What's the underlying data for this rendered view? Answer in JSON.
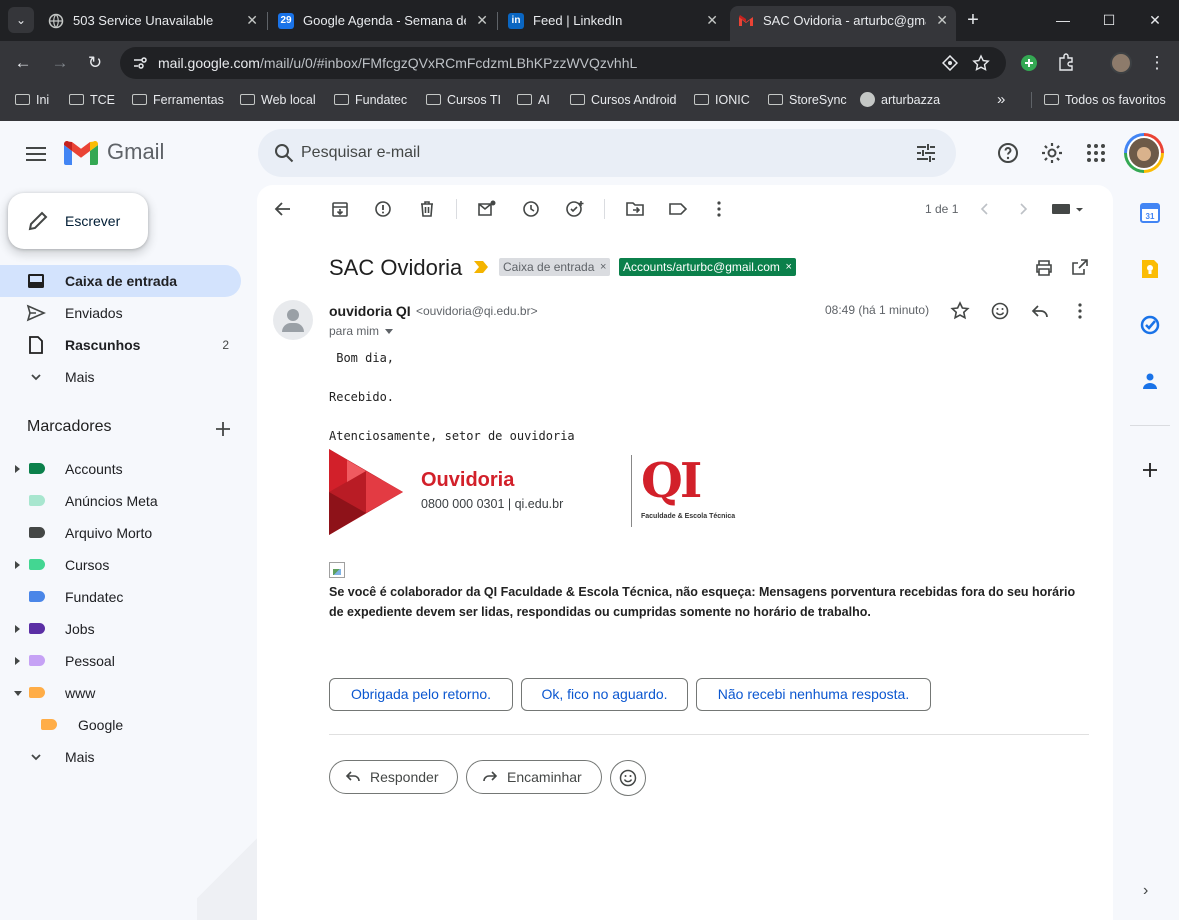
{
  "browser": {
    "tabs": [
      {
        "title": "503 Service Unavailable",
        "icon": "globe-icon"
      },
      {
        "title": "Google Agenda - Semana de",
        "icon": "calendar-icon"
      },
      {
        "title": "Feed | LinkedIn",
        "icon": "linkedin-icon"
      },
      {
        "title": "SAC Ovidoria - arturbc@gmai",
        "icon": "gmail-icon",
        "active": true
      }
    ],
    "url_host": "mail.google.com",
    "url_path": "/mail/u/0/#inbox/FMfcgzQVxRCmFcdzmLBhKPzzWVQzvhhL",
    "bookmarks": [
      "Ini",
      "TCE",
      "Ferramentas",
      "Web local",
      "Fundatec",
      "Cursos TI",
      "AI",
      "Cursos Android",
      "IONIC",
      "StoreSync",
      "arturbazza"
    ],
    "bookmarks_overflow": "»",
    "bookmarks_all": "Todos os favoritos"
  },
  "gmail": {
    "brand": "Gmail",
    "search_placeholder": "Pesquisar e-mail",
    "compose_label": "Escrever",
    "nav": [
      {
        "label": "Caixa de entrada",
        "selected": true,
        "bold": true
      },
      {
        "label": "Enviados"
      },
      {
        "label": "Rascunhos",
        "bold": true,
        "count": "2"
      },
      {
        "label": "Mais"
      }
    ],
    "labels_title": "Marcadores",
    "labels": [
      {
        "name": "Accounts",
        "color": "#0b804b",
        "expandable": true
      },
      {
        "name": "Anúncios Meta",
        "color": "#a8e6cf"
      },
      {
        "name": "Arquivo Morto",
        "color": "#444746"
      },
      {
        "name": "Cursos",
        "color": "#43d692",
        "expandable": true
      },
      {
        "name": "Fundatec",
        "color": "#4a86e8"
      },
      {
        "name": "Jobs",
        "color": "#5b2fa5",
        "expandable": true
      },
      {
        "name": "Pessoal",
        "color": "#c6a2f5",
        "expandable": true
      },
      {
        "name": "www",
        "color": "#ffad47",
        "expanded": true
      },
      {
        "name": "Google",
        "color": "#ffad47",
        "child": true
      }
    ],
    "labels_more": "Mais"
  },
  "message": {
    "pager": "1 de 1",
    "subject": "SAC Ovidoria",
    "chips": [
      {
        "label": "Caixa de entrada",
        "close": "×"
      },
      {
        "label": "Accounts/arturbc@gmail.com",
        "close": "×"
      }
    ],
    "sender_name": "ouvidoria QI",
    "sender_email": "<ouvidoria@qi.edu.br>",
    "to": "para mim",
    "time": "08:49 (há 1 minuto)",
    "greeting": " Bom dia,",
    "line1": "Recebido.",
    "line2": "Atenciosamente, setor de ouvidoria",
    "sig_title": "Ouvidoria",
    "sig_contact": "0800 000 0301 | qi.edu.br",
    "sig_logo": "QI",
    "sig_logo_sub": "Faculdade & Escola Técnica",
    "warning": "Se você é colaborador da QI Faculdade & Escola Técnica, não esqueça: Mensagens porventura recebidas fora do seu horário de expediente devem ser lidas, respondidas ou cumpridas somente no horário de trabalho.",
    "smart_replies": [
      "Obrigada pelo retorno.",
      "Ok, fico no aguardo.",
      "Não recebi nenhuma resposta."
    ],
    "reply_label": "Responder",
    "forward_label": "Encaminhar"
  },
  "colors": {
    "accent": "#0b57d0",
    "selected_nav": "#d3e3fd",
    "brand_red": "#d2202a"
  }
}
